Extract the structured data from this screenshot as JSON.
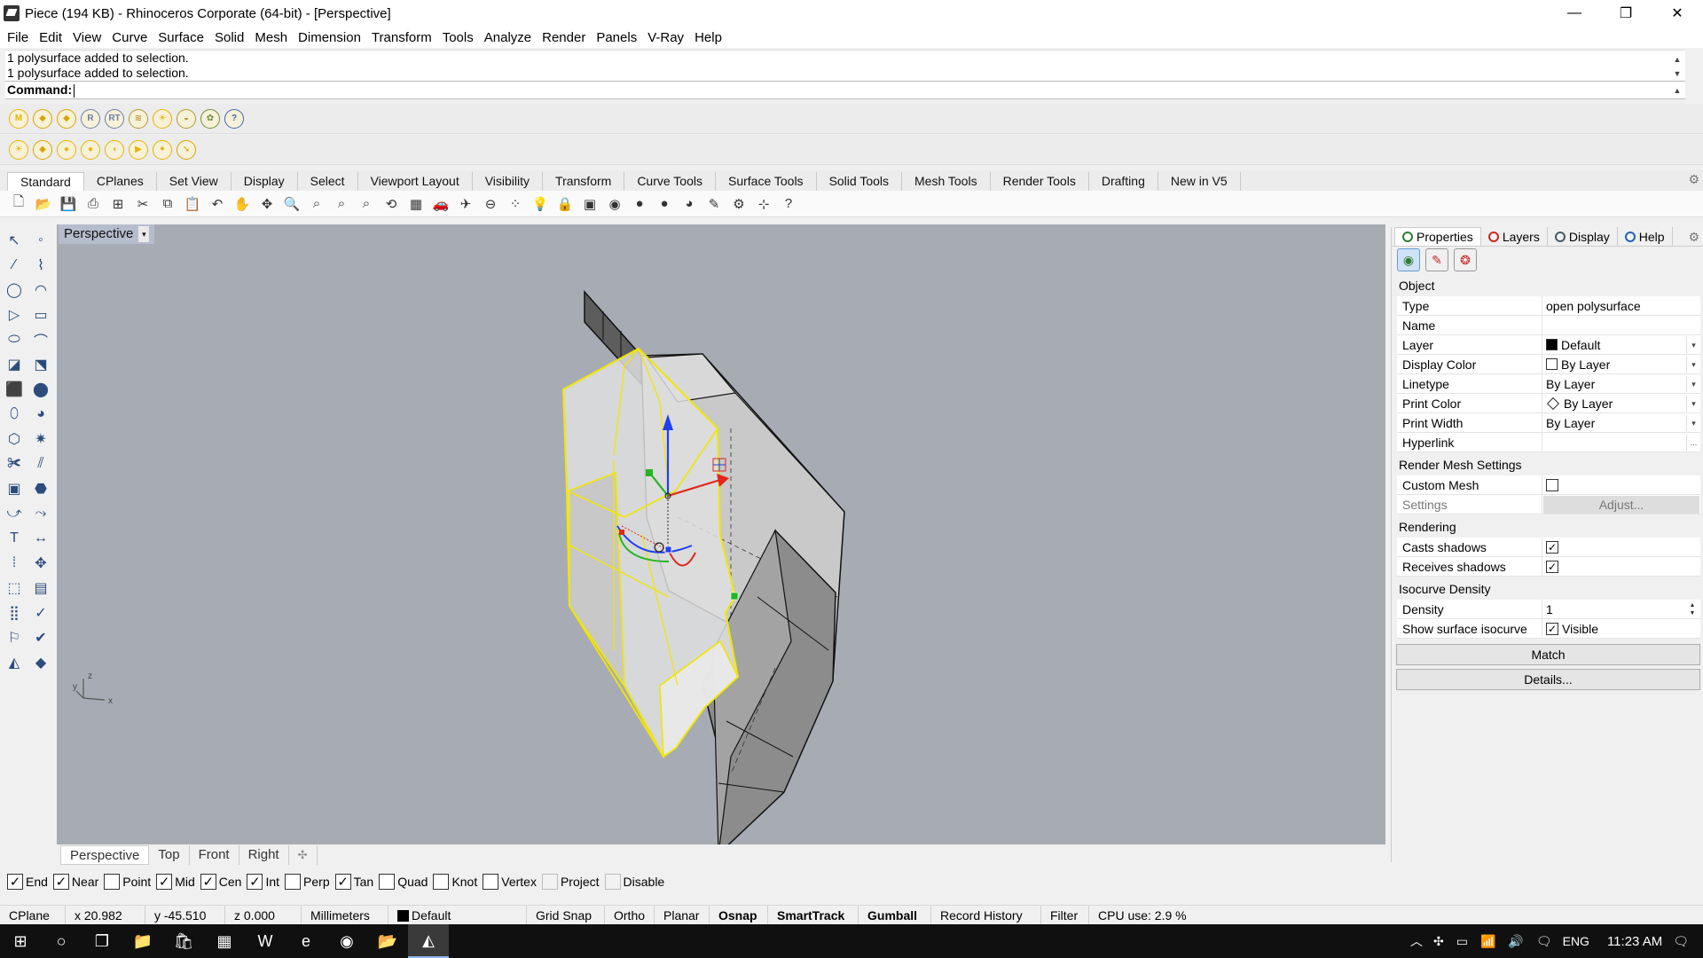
{
  "window": {
    "title": "Piece (194 KB) - Rhinoceros Corporate (64-bit) - [Perspective]",
    "minimize": "—",
    "restore": "❐",
    "close": "✕"
  },
  "menu": [
    "File",
    "Edit",
    "View",
    "Curve",
    "Surface",
    "Solid",
    "Mesh",
    "Dimension",
    "Transform",
    "Tools",
    "Analyze",
    "Render",
    "Panels",
    "V-Ray",
    "Help"
  ],
  "command": {
    "history": [
      "1 polysurface added to selection.",
      "1 polysurface added to selection."
    ],
    "prompt": "Command:",
    "value": ""
  },
  "plugin_toolbar_1": [
    {
      "icon": "vray-material-icon",
      "glyph": "M",
      "color": "#e8b400"
    },
    {
      "icon": "vray-lights-icon",
      "glyph": "◆",
      "color": "#d9a400"
    },
    {
      "icon": "vray-tags-icon",
      "glyph": "◆",
      "color": "#d9a400"
    },
    {
      "icon": "vray-render-icon",
      "glyph": "R",
      "color": "#6d7fa8"
    },
    {
      "icon": "vray-rt-icon",
      "glyph": "RT",
      "color": "#6d7fa8"
    },
    {
      "icon": "vray-frame-icon",
      "glyph": "≋",
      "color": "#b49a30"
    },
    {
      "icon": "vray-sun-icon",
      "glyph": "☀",
      "color": "#e8b400"
    },
    {
      "icon": "vray-dome-icon",
      "glyph": "◒",
      "color": "#b49a30"
    },
    {
      "icon": "vray-fur-icon",
      "glyph": "✿",
      "color": "#6b8f3e"
    },
    {
      "icon": "vray-help-icon",
      "glyph": "?",
      "color": "#3c6bb0"
    }
  ],
  "plugin_toolbar_2": [
    {
      "icon": "vray-sun-light-icon",
      "glyph": "☀",
      "color": "#e8b400"
    },
    {
      "icon": "vray-spot-light-icon",
      "glyph": "◆",
      "color": "#d9a400"
    },
    {
      "icon": "vray-sphere-light-icon",
      "glyph": "●",
      "color": "#e8b400"
    },
    {
      "icon": "vray-omni-light-icon",
      "glyph": "●",
      "color": "#e8b400"
    },
    {
      "icon": "vray-rect-light-icon",
      "glyph": "◖",
      "color": "#e8b400"
    },
    {
      "icon": "vray-ies-light-icon",
      "glyph": "▶",
      "color": "#e8b400"
    },
    {
      "icon": "vray-dir-light-icon",
      "glyph": "✦",
      "color": "#e8b400"
    },
    {
      "icon": "vray-mesh-light-icon",
      "glyph": "➘",
      "color": "#d9a400"
    }
  ],
  "toolbar_tabs": [
    "Standard",
    "CPlanes",
    "Set View",
    "Display",
    "Select",
    "Viewport Layout",
    "Visibility",
    "Transform",
    "Curve Tools",
    "Surface Tools",
    "Solid Tools",
    "Mesh Tools",
    "Render Tools",
    "Drafting",
    "New in V5"
  ],
  "standard_toolbar": [
    {
      "icon": "new-file-icon",
      "glyph": "🗋"
    },
    {
      "icon": "open-file-icon",
      "glyph": "📂"
    },
    {
      "icon": "save-icon",
      "glyph": "💾"
    },
    {
      "icon": "print-icon",
      "glyph": "⎙"
    },
    {
      "icon": "template-icon",
      "glyph": "⊞"
    },
    {
      "icon": "cut-icon",
      "glyph": "✂"
    },
    {
      "icon": "copy-icon",
      "glyph": "⧉"
    },
    {
      "icon": "paste-icon",
      "glyph": "📋"
    },
    {
      "icon": "undo-icon",
      "glyph": "↶"
    },
    {
      "icon": "pan-icon",
      "glyph": "✋"
    },
    {
      "icon": "rotate-view-icon",
      "glyph": "✥"
    },
    {
      "icon": "zoom-icon",
      "glyph": "🔍"
    },
    {
      "icon": "zoom-window-icon",
      "glyph": "⌕"
    },
    {
      "icon": "zoom-extents-icon",
      "glyph": "⌕"
    },
    {
      "icon": "zoom-selected-icon",
      "glyph": "⌕"
    },
    {
      "icon": "rotate-icon",
      "glyph": "⟲"
    },
    {
      "icon": "four-view-icon",
      "glyph": "▦"
    },
    {
      "icon": "car-icon",
      "glyph": "🚗"
    },
    {
      "icon": "named-view-icon",
      "glyph": "✈"
    },
    {
      "icon": "cplane-icon",
      "glyph": "⊖"
    },
    {
      "icon": "select-points-icon",
      "glyph": "⁘"
    },
    {
      "icon": "light-icon",
      "glyph": "💡"
    },
    {
      "icon": "lock-icon",
      "glyph": "🔒"
    },
    {
      "icon": "layers-icon",
      "glyph": "▣"
    },
    {
      "icon": "color-icon",
      "glyph": "◉"
    },
    {
      "icon": "shaded-icon",
      "glyph": "●"
    },
    {
      "icon": "rendered-icon",
      "glyph": "●"
    },
    {
      "icon": "render-sphere-icon",
      "glyph": "◕"
    },
    {
      "icon": "wand-icon",
      "glyph": "✎"
    },
    {
      "icon": "options-icon",
      "glyph": "⚙"
    },
    {
      "icon": "snap-icon",
      "glyph": "⊹"
    },
    {
      "icon": "help-icon",
      "glyph": "?"
    }
  ],
  "left_toolbar": [
    "select-arrow-icon",
    "point-icon",
    "polyline-icon",
    "curve-icon",
    "circle-icon",
    "arc-icon",
    "polygon-icon",
    "rectangle-icon",
    "ellipse-icon",
    "fillet-curve-icon",
    "surface-icon",
    "extrude-icon",
    "box-icon",
    "solid-union-icon",
    "cylinder-icon",
    "sphere-icon",
    "mesh-icon",
    "explode-icon",
    "trim-icon",
    "split-icon",
    "group-icon",
    "boolean-icon",
    "blend-icon",
    "offset-icon",
    "text-icon",
    "dimension-icon",
    "array-icon",
    "move-icon",
    "block-icon",
    "hatch-icon",
    "grid-icon",
    "check-icon",
    "analyze-icon",
    "confirm-icon",
    "render-icon",
    "light-icon"
  ],
  "left_toolbar_glyphs": [
    "↖",
    "◦",
    "∕",
    "⌇",
    "◯",
    "◠",
    "▷",
    "▭",
    "⬭",
    "⌒",
    "◪",
    "⬔",
    "⬛",
    "⬤",
    "⬯",
    "◕",
    "⬡",
    "✷",
    "✀",
    "⫽",
    "▣",
    "⬣",
    "⤻",
    "⤳",
    "T",
    "↔",
    "⁞",
    "✥",
    "⬚",
    "▤",
    "⣿",
    "✓",
    "⚐",
    "✔",
    "◭",
    "◆"
  ],
  "viewport": {
    "label": "Perspective",
    "dropdown": "▾",
    "axis_y": "y",
    "axis_z": "z",
    "axis_x": "x"
  },
  "viewport_tabs": [
    "Perspective",
    "Top",
    "Front",
    "Right"
  ],
  "viewport_tab_add": "✣",
  "osnap": [
    {
      "label": "End",
      "checked": true
    },
    {
      "label": "Near",
      "checked": true
    },
    {
      "label": "Point",
      "checked": false
    },
    {
      "label": "Mid",
      "checked": true
    },
    {
      "label": "Cen",
      "checked": true
    },
    {
      "label": "Int",
      "checked": true
    },
    {
      "label": "Perp",
      "checked": false
    },
    {
      "label": "Tan",
      "checked": true
    },
    {
      "label": "Quad",
      "checked": false
    },
    {
      "label": "Knot",
      "checked": false
    },
    {
      "label": "Vertex",
      "checked": false
    },
    {
      "label": "Project",
      "checked": false,
      "disabled": true
    },
    {
      "label": "Disable",
      "checked": false,
      "disabled": true
    }
  ],
  "status": {
    "cplane": "CPlane",
    "x": "x 20.982",
    "y": "y -45.510",
    "z": "z 0.000",
    "units": "Millimeters",
    "layer": "Default",
    "grid_snap": "Grid Snap",
    "ortho": "Ortho",
    "planar": "Planar",
    "osnap": "Osnap",
    "smarttrack": "SmartTrack",
    "gumball": "Gumball",
    "record_history": "Record History",
    "filter": "Filter",
    "cpu": "CPU use: 2.9 %"
  },
  "panel": {
    "tabs": [
      {
        "label": "Properties",
        "icon": "properties-icon",
        "color": "#2e7d32"
      },
      {
        "label": "Layers",
        "icon": "layers-icon",
        "color": "#c62828"
      },
      {
        "label": "Display",
        "icon": "display-icon",
        "color": "#455a64"
      },
      {
        "label": "Help",
        "icon": "help-icon",
        "color": "#1e63b8"
      }
    ],
    "section_object": "Object",
    "rows_object": [
      {
        "label": "Type",
        "value": "open polysurface"
      },
      {
        "label": "Name",
        "value": ""
      },
      {
        "label": "Layer",
        "value": "Default"
      },
      {
        "label": "Display Color",
        "value": "By Layer"
      },
      {
        "label": "Linetype",
        "value": "By Layer"
      },
      {
        "label": "Print Color",
        "value": "By Layer"
      },
      {
        "label": "Print Width",
        "value": "By Layer"
      },
      {
        "label": "Hyperlink",
        "value": "",
        "button": "..."
      }
    ],
    "section_mesh": "Render Mesh Settings",
    "custom_mesh_label": "Custom Mesh",
    "settings_label": "Settings",
    "adjust_label": "Adjust...",
    "section_rendering": "Rendering",
    "casts_shadows_label": "Casts shadows",
    "receives_shadows_label": "Receives shadows",
    "section_isocurve": "Isocurve Density",
    "density_label": "Density",
    "density_value": "1",
    "show_isocurve_label": "Show surface isocurve",
    "visible_label": "Visible",
    "match_label": "Match",
    "details_label": "Details...",
    "check": "✓",
    "dropdown": "▾",
    "spin_up": "▲",
    "spin_down": "▼"
  },
  "taskbar": {
    "start": "⊞",
    "search": "○",
    "task_view": "❐",
    "apps": [
      {
        "icon": "file-explorer-icon",
        "glyph": "📁"
      },
      {
        "icon": "store-icon",
        "glyph": "🛍"
      },
      {
        "icon": "calculator-icon",
        "glyph": "▦"
      },
      {
        "icon": "word-icon",
        "glyph": "W"
      },
      {
        "icon": "edge-icon",
        "glyph": "e"
      },
      {
        "icon": "chrome-icon",
        "glyph": "◉"
      },
      {
        "icon": "folder-icon",
        "glyph": "📂"
      },
      {
        "icon": "rhino-icon",
        "glyph": "◭"
      }
    ],
    "tray_up": "︿",
    "tray_icons": [
      "✣",
      "▭",
      "📶",
      "🔊",
      "🗨"
    ],
    "language": "ENG",
    "time": "11:23 AM",
    "notification": "🗨"
  },
  "colors": {
    "viewport_bg": "#a7acb4",
    "selection_yellow": "#f2e600",
    "gumball_x": "#e0261a",
    "gumball_y": "#23b523",
    "gumball_z": "#1f3ff0"
  }
}
